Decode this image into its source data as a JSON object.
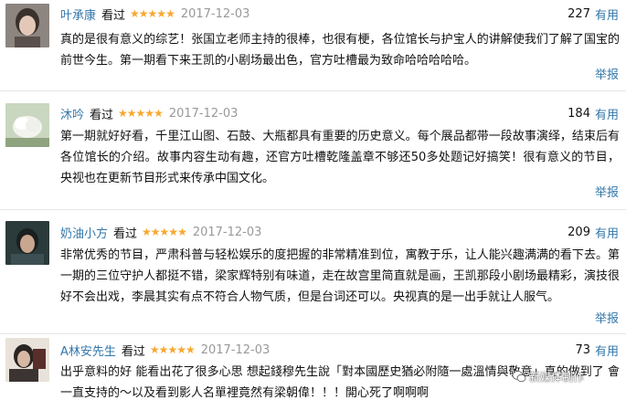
{
  "reviews": [
    {
      "author": "叶承康",
      "status": "看过",
      "stars": "★★★★★",
      "date": "2017-12-03",
      "useful_count": "227",
      "useful_label": "有用",
      "text": "真的是很有意义的综艺！张国立老师主持的很棒，也很有梗，各位馆长与护宝人的讲解使我们了解了国宝的前世今生。第一期看下来王凯的小剧场最出色，官方吐槽最为致命哈哈哈哈哈。",
      "report": "举报"
    },
    {
      "author": "沐吟",
      "status": "看过",
      "stars": "★★★★★",
      "date": "2017-12-03",
      "useful_count": "184",
      "useful_label": "有用",
      "text": "第一期就好好看，千里江山图、石鼓、大瓶都具有重要的历史意义。每个展品都带一段故事演绎，结束后有各位馆长的介绍。故事内容生动有趣，还官方吐槽乾隆盖章不够还50多处题记好搞笑！很有意义的节目，央视也在更新节目形式来传承中国文化。",
      "report": "举报"
    },
    {
      "author": "奶油小方",
      "status": "看过",
      "stars": "★★★★★",
      "date": "2017-12-03",
      "useful_count": "209",
      "useful_label": "有用",
      "text": "非常优秀的节目，严肃科普与轻松娱乐的度把握的非常精准到位，寓教于乐，让人能兴趣满满的看下去。第一期的三位守护人都挺不错，梁家辉特别有味道，走在故宫里简直就是画，王凯那段小剧场最精彩，演技很好不会出戏，李晨其实有点不符合人物气质，但是台词还可以。央视真的是一出手就让人服气。",
      "report": "举报"
    },
    {
      "author": "A林安先生",
      "status": "看过",
      "stars": "★★★★★",
      "date": "2017-12-03",
      "useful_count": "73",
      "useful_label": "有用",
      "text": "出乎意料的好 能看出花了很多心思 想起錢穆先生說「對本國歷史猶必附隨一處溫情與敬意」真的做到了 會一直支持的～以及看到影人名單裡竟然有梁朝偉！！！開心死了啊啊啊",
      "report": ""
    }
  ],
  "watermark": "新媒体制作"
}
